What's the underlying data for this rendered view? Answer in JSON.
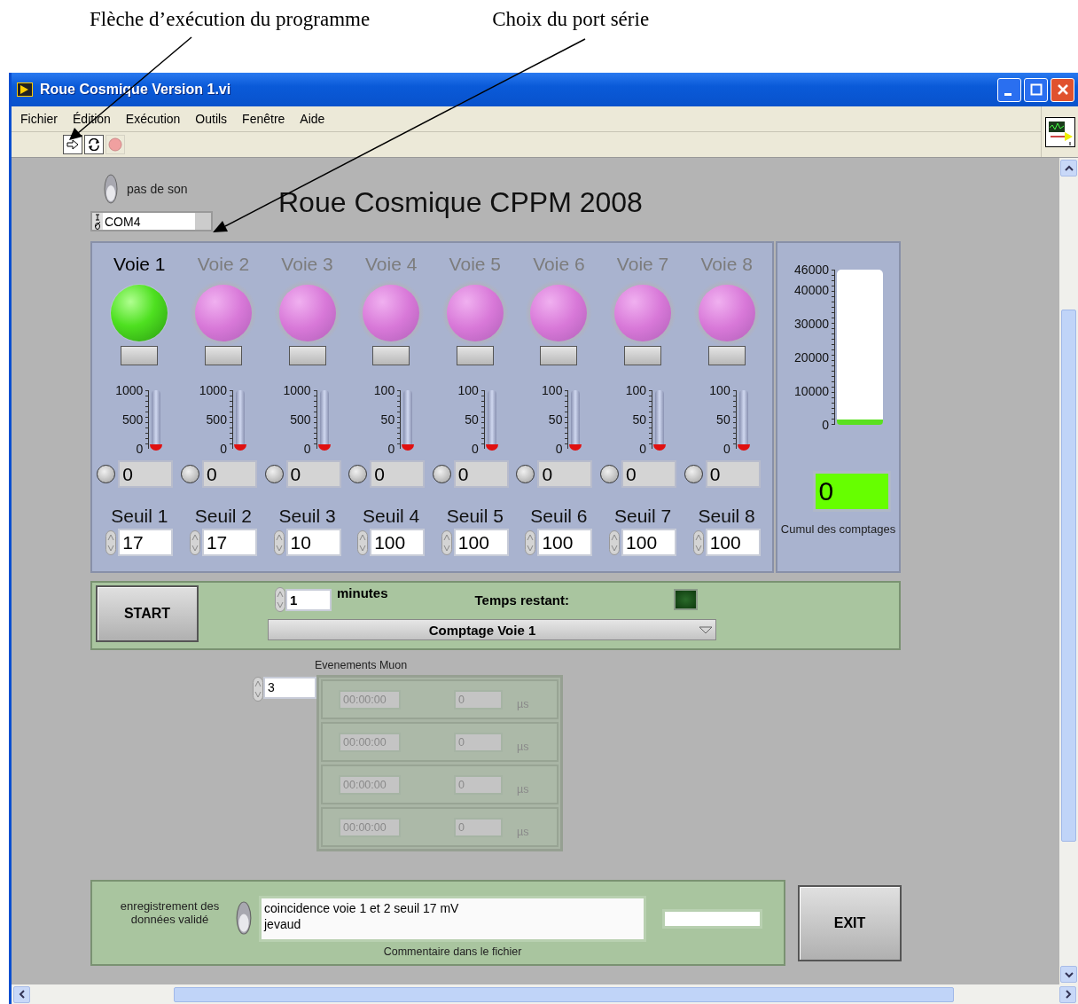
{
  "annotations": [
    {
      "text": "Flèche d’exécution du programme"
    },
    {
      "text": "Choix du port série"
    }
  ],
  "window": {
    "title": "Roue Cosmique Version 1.vi"
  },
  "menu": [
    "Fichier",
    "Édition",
    "Exécution",
    "Outils",
    "Fenêtre",
    "Aide"
  ],
  "sound_switch": {
    "label": "pas de son",
    "on": false
  },
  "serial_port": {
    "value": "COM4"
  },
  "heading": "Roue Cosmique CPPM 2008",
  "channels": [
    {
      "label": "Voie 1",
      "active": true,
      "scale": [
        "1000",
        "500",
        "0"
      ],
      "level": 0,
      "count": "0",
      "threshold_label": "Seuil 1",
      "threshold": "17"
    },
    {
      "label": "Voie 2",
      "active": false,
      "scale": [
        "1000",
        "500",
        "0"
      ],
      "level": 0,
      "count": "0",
      "threshold_label": "Seuil 2",
      "threshold": "17"
    },
    {
      "label": "Voie 3",
      "active": false,
      "scale": [
        "1000",
        "500",
        "0"
      ],
      "level": 0,
      "count": "0",
      "threshold_label": "Seuil 3",
      "threshold": "10"
    },
    {
      "label": "Voie 4",
      "active": false,
      "scale": [
        "100",
        "50",
        "0"
      ],
      "level": 0,
      "count": "0",
      "threshold_label": "Seuil 4",
      "threshold": "100"
    },
    {
      "label": "Voie 5",
      "active": false,
      "scale": [
        "100",
        "50",
        "0"
      ],
      "level": 0,
      "count": "0",
      "threshold_label": "Seuil 5",
      "threshold": "100"
    },
    {
      "label": "Voie 6",
      "active": false,
      "scale": [
        "100",
        "50",
        "0"
      ],
      "level": 0,
      "count": "0",
      "threshold_label": "Seuil 6",
      "threshold": "100"
    },
    {
      "label": "Voie 7",
      "active": false,
      "scale": [
        "100",
        "50",
        "0"
      ],
      "level": 0,
      "count": "0",
      "threshold_label": "Seuil 7",
      "threshold": "100"
    },
    {
      "label": "Voie 8",
      "active": false,
      "scale": [
        "100",
        "50",
        "0"
      ],
      "level": 0,
      "count": "0",
      "threshold_label": "Seuil 8",
      "threshold": "100"
    }
  ],
  "total": {
    "scale": [
      "46000",
      "40000",
      "30000",
      "20000",
      "10000",
      "0"
    ],
    "level": 0,
    "value": "0",
    "label": "Cumul des comptages"
  },
  "run": {
    "start_label": "START",
    "duration": "1",
    "duration_unit": "minutes",
    "remaining_label": "Temps restant:",
    "remaining_led_on": false,
    "mode": "Comptage Voie 1"
  },
  "events": {
    "label": "Evenements Muon",
    "index": "3",
    "disabled": true,
    "rows": [
      {
        "time": "00:00:00",
        "value": "0",
        "unit": "µs"
      },
      {
        "time": "00:00:00",
        "value": "0",
        "unit": "µs"
      },
      {
        "time": "00:00:00",
        "value": "0",
        "unit": "µs"
      },
      {
        "time": "00:00:00",
        "value": "0",
        "unit": "µs"
      }
    ]
  },
  "recording": {
    "label": "enregistrement des données validé",
    "on": false,
    "comment": [
      "coincidence voie 1 et 2 seuil 17 mV",
      "jevaud"
    ],
    "comment_label": "Commentaire dans le fichier",
    "exit_label": "EXIT"
  }
}
